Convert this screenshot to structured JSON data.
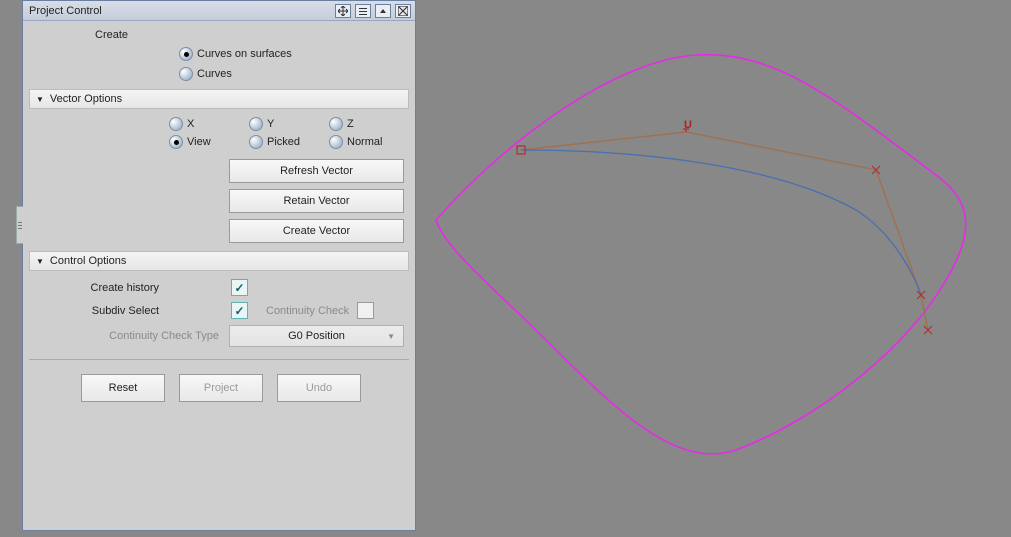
{
  "window": {
    "title": "Project Control"
  },
  "create": {
    "heading": "Create",
    "opt_cos": "Curves on surfaces",
    "opt_curves": "Curves"
  },
  "vector": {
    "heading": "Vector Options",
    "x": "X",
    "y": "Y",
    "z": "Z",
    "view": "View",
    "picked": "Picked",
    "normal": "Normal",
    "refresh": "Refresh Vector",
    "retain": "Retain Vector",
    "create_vec": "Create Vector"
  },
  "control": {
    "heading": "Control Options",
    "create_history": "Create history",
    "subdiv_select": "Subdiv Select",
    "continuity_check": "Continuity Check",
    "cc_type_label": "Continuity Check Type",
    "cc_type_value": "G0 Position"
  },
  "footer": {
    "reset": "Reset",
    "project": "Project",
    "undo": "Undo"
  }
}
